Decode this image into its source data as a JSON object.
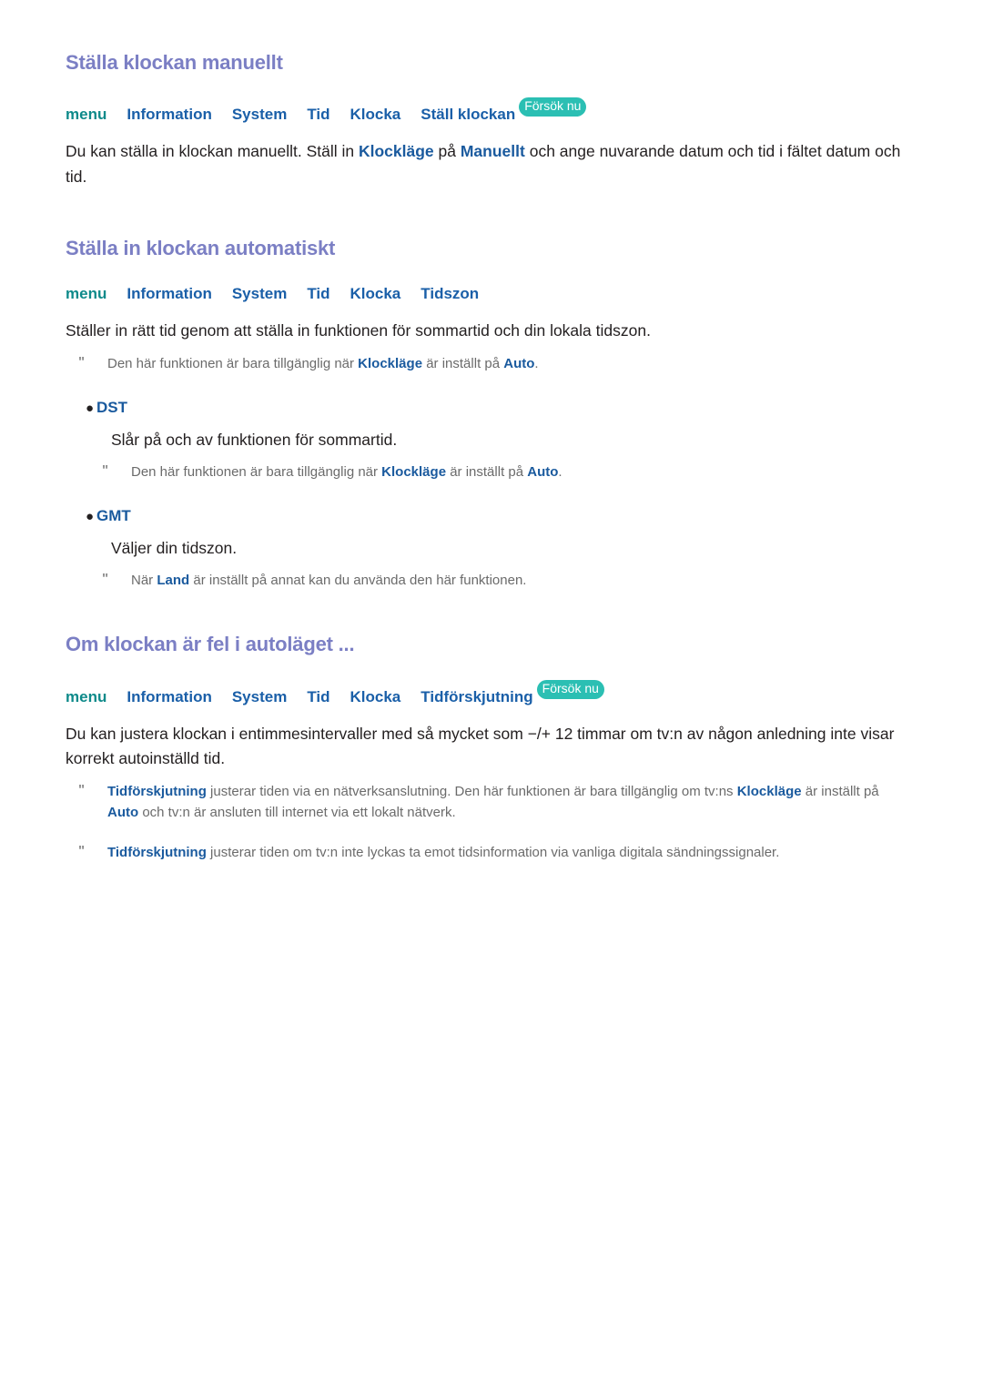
{
  "colors": {
    "heading": "#7b7fc4",
    "crumb_blue": "#1a5fa8",
    "crumb_teal": "#0e8a8a",
    "badge_bg": "#2bbfb3",
    "emphasis_blue": "#1a5a9e",
    "body_text": "#231f20",
    "note_text": "#6b6b6b"
  },
  "sections": [
    {
      "heading": "Ställa klockan manuellt",
      "breadcrumb": {
        "root": "menu",
        "items": [
          "Information",
          "System",
          "Tid",
          "Klocka",
          "Ställ klockan"
        ],
        "badge": "Försök nu"
      },
      "paragraph": {
        "pre": "Du kan ställa in klockan manuellt. Ställ in ",
        "em1": "Klockläge",
        "mid1": " på ",
        "em2": "Manuellt",
        "post": " och ange nuvarande datum och tid i fältet datum och tid."
      }
    },
    {
      "heading": "Ställa in klockan automatiskt",
      "breadcrumb": {
        "root": "menu",
        "items": [
          "Information",
          "System",
          "Tid",
          "Klocka",
          "Tidszon"
        ],
        "badge": null
      },
      "paragraph": {
        "full": "Ställer in rätt tid genom att ställa in funktionen för sommartid och din lokala tidszon."
      },
      "note": {
        "marker": "\"",
        "pre": "Den här funktionen är bara tillgänglig när ",
        "em1": "Klockläge",
        "mid": " är inställt på ",
        "em2": "Auto",
        "post": "."
      },
      "bullets": [
        {
          "marker": "●",
          "label": "DST",
          "description": "Slår på och av funktionen för sommartid.",
          "note": {
            "marker": "\"",
            "pre": "Den här funktionen är bara tillgänglig när ",
            "em1": "Klockläge",
            "mid": " är inställt på ",
            "em2": "Auto",
            "post": "."
          }
        },
        {
          "marker": "●",
          "label": "GMT",
          "description": "Väljer din tidszon.",
          "note": {
            "marker": "\"",
            "pre": "När ",
            "em1": "Land",
            "mid": " är inställt på annat kan du använda den här funktionen.",
            "em2": "",
            "post": ""
          }
        }
      ]
    },
    {
      "heading": "Om klockan är fel i autoläget ...",
      "breadcrumb": {
        "root": "menu",
        "items": [
          "Information",
          "System",
          "Tid",
          "Klocka",
          "Tidförskjutning"
        ],
        "badge": "Försök nu"
      },
      "paragraph": {
        "full": "Du kan justera klockan i entimmesintervaller med så mycket som −/+ 12 timmar om tv:n av någon anledning inte visar korrekt autoinställd tid."
      },
      "notes": [
        {
          "marker": "\"",
          "em1": "Tidförskjutning",
          "pre": " justerar tiden via en nätverksanslutning. Den här funktionen är bara tillgänglig om tv:ns ",
          "em2": "Klockläge",
          "mid": " är inställt på ",
          "em3": "Auto",
          "post": " och tv:n är ansluten till internet via ett lokalt nätverk."
        },
        {
          "marker": "\"",
          "em1": "Tidförskjutning",
          "pre": " justerar tiden om tv:n inte lyckas ta emot tidsinformation via vanliga digitala sändningssignaler.",
          "em2": "",
          "mid": "",
          "em3": "",
          "post": ""
        }
      ]
    }
  ]
}
